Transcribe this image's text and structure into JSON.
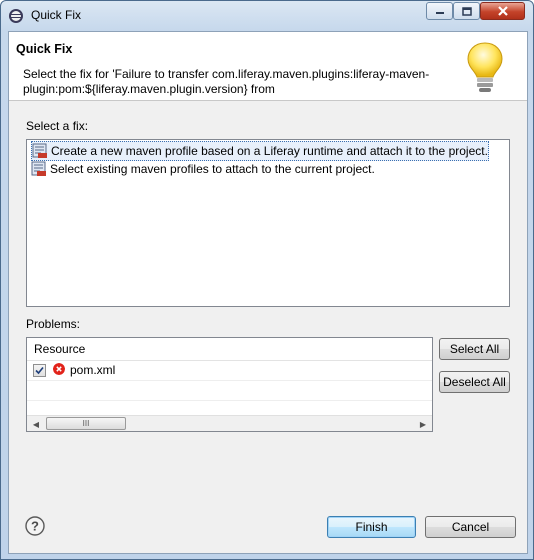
{
  "window": {
    "title": "Quick Fix"
  },
  "header": {
    "title": "Quick Fix",
    "description": "Select the fix for 'Failure to transfer com.liferay.maven.plugins:liferay-maven-plugin:pom:${liferay.maven.plugin.version} from"
  },
  "fixes": {
    "label": "Select a fix:",
    "items": [
      {
        "label": "Create a new maven profile based on a Liferay runtime and attach it to the project.",
        "selected": true
      },
      {
        "label": "Select existing maven profiles to attach to the current project.",
        "selected": false
      }
    ]
  },
  "problems": {
    "label": "Problems:",
    "column": "Resource",
    "rows": [
      {
        "resource": "pom.xml",
        "checked": true,
        "severity": "error"
      }
    ],
    "scroll_thumb_grip": "III"
  },
  "buttons": {
    "select_all": "Select All",
    "deselect_all": "Deselect All",
    "finish": "Finish",
    "cancel": "Cancel"
  },
  "colors": {
    "error": "#e2231a",
    "accent": "#3c7fb1"
  }
}
